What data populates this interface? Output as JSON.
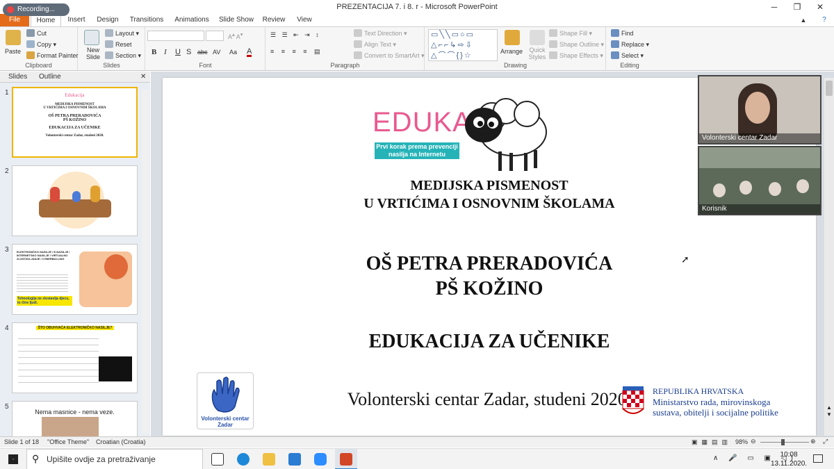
{
  "window": {
    "title": "PREZENTACIJA 7. i 8. r  -  Microsoft PowerPoint",
    "recording_label": "Recording..."
  },
  "ribbon_tabs": [
    "File",
    "Home",
    "Insert",
    "Design",
    "Transitions",
    "Animations",
    "Slide Show",
    "Review",
    "View"
  ],
  "ribbon": {
    "clipboard": {
      "paste": "Paste",
      "cut": "Cut",
      "copy": "Copy",
      "format_painter": "Format Painter",
      "label": "Clipboard"
    },
    "slides": {
      "new_slide": "New Slide",
      "layout": "Layout",
      "reset": "Reset",
      "section": "Section",
      "label": "Slides"
    },
    "font": {
      "label": "Font",
      "bold": "B",
      "italic": "I",
      "underline": "U",
      "strike": "S",
      "shadow": "abc",
      "spacing": "AV",
      "case": "Aa",
      "color": "A"
    },
    "paragraph": {
      "text_direction": "Text Direction",
      "align_text": "Align Text",
      "smartart": "Convert to SmartArt",
      "label": "Paragraph"
    },
    "drawing": {
      "arrange": "Arrange",
      "quick_styles": "Quick Styles",
      "shape_fill": "Shape Fill",
      "shape_outline": "Shape Outline",
      "shape_effects": "Shape Effects",
      "label": "Drawing"
    },
    "editing": {
      "find": "Find",
      "replace": "Replace",
      "select": "Select",
      "label": "Editing"
    }
  },
  "panes": {
    "slides_tab": "Slides",
    "outline_tab": "Outline"
  },
  "thumbnails": [
    {
      "num": "1",
      "lines": [
        "Edukacija",
        "MEDIJSKA PISMENOST",
        "U VRTIĆIMA I OSNOVNIM ŠKOLAMA",
        "OŠ PETRA PRERADOVIĆA",
        "PŠ KOŽINO",
        "EDUKACIJA ZA UČENIKE",
        "Volonterski centar Zadar, studeni 2020."
      ]
    },
    {
      "num": "2"
    },
    {
      "num": "3",
      "lines": [
        "ELEKTRONIČKO NASILJE / E-NASILJE / INTERNETSKO NASILJE / VIRTUALNO ZLOSTAVLJANJE / CYBERBULLING",
        "Tehnologija ne zlostavlja djecu, to čine ljudi."
      ]
    },
    {
      "num": "4",
      "lines": [
        "ŠTO OBUHVAĆA ELEKTRONIČKO NASILJE?"
      ]
    },
    {
      "num": "5",
      "lines": [
        "Nema masnice - nema veze."
      ]
    }
  ],
  "slide": {
    "logo_title": "EDUKACIJA",
    "logo_tagline": "Prvi korak prema prevenciji nasilja na Internetu",
    "subtitle_line1": "MEDIJSKA PISMENOST",
    "subtitle_line2": "U VRTIĆIMA I OSNOVNIM ŠKOLAMA",
    "school_line1": "OŠ PETRA PRERADOVIĆA",
    "school_line2": "PŠ KOŽINO",
    "education": "EDUKACIJA ZA UČENIKE",
    "footer": "Volonterski centar Zadar, studeni 2020.",
    "vcz_logo": "Volonterski centar Zadar",
    "ministry_line1": "REPUBLIKA HRVATSKA",
    "ministry_line2": "Ministarstvo rada, mirovinskoga",
    "ministry_line3": "sustava, obitelji i socijalne politike"
  },
  "video": [
    {
      "name": "Volonterski centar Zadar"
    },
    {
      "name": "Korisnik"
    }
  ],
  "status": {
    "slide_of": "Slide 1 of 18",
    "theme": "\"Office Theme\"",
    "language": "Croatian (Croatia)",
    "zoom": "98%"
  },
  "taskbar": {
    "search_placeholder": "Upišite ovdje za pretraživanje",
    "time": "10:08",
    "date": "13.11.2020."
  },
  "colors": {
    "file_tab": "#e46b1a",
    "edukacija_pink": "#e85a8f",
    "tagline_teal": "#26b3b8",
    "ministry_blue": "#1a3d8f",
    "ribbon": "#f6f6f6"
  }
}
